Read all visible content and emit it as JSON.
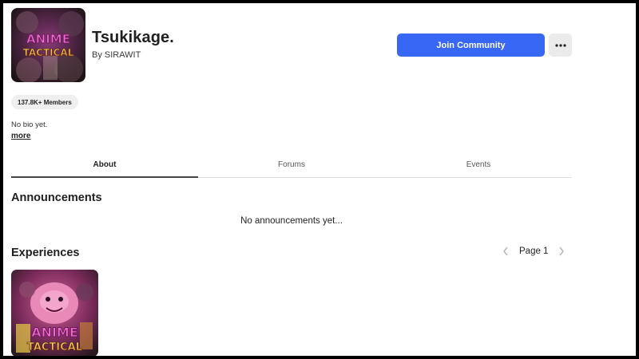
{
  "group": {
    "name": "Tsukikage.",
    "owner": "By SIRAWIT",
    "icon_logo_lines": [
      "ANIME",
      "TACTICAL"
    ]
  },
  "actions": {
    "join_label": "Join Community",
    "more_icon": "ellipsis-icon"
  },
  "stats": {
    "members_label": "137.8K+ Members"
  },
  "bio": {
    "text": "No bio yet.",
    "more_label": "more"
  },
  "tabs": [
    {
      "label": "About",
      "active": true
    },
    {
      "label": "Forums",
      "active": false
    },
    {
      "label": "Events",
      "active": false
    }
  ],
  "announcements": {
    "title": "Announcements",
    "empty_text": "No announcements yet..."
  },
  "experiences": {
    "title": "Experiences",
    "page_label": "Page 1",
    "prev_icon": "chevron-left-icon",
    "next_icon": "chevron-right-icon",
    "items": [
      {
        "logo_lines": [
          "ANIME",
          "TACTICAL"
        ]
      }
    ]
  },
  "colors": {
    "accent": "#3866f5",
    "logo_pink": "#f26bd0",
    "logo_yellow": "#ffd23a"
  }
}
